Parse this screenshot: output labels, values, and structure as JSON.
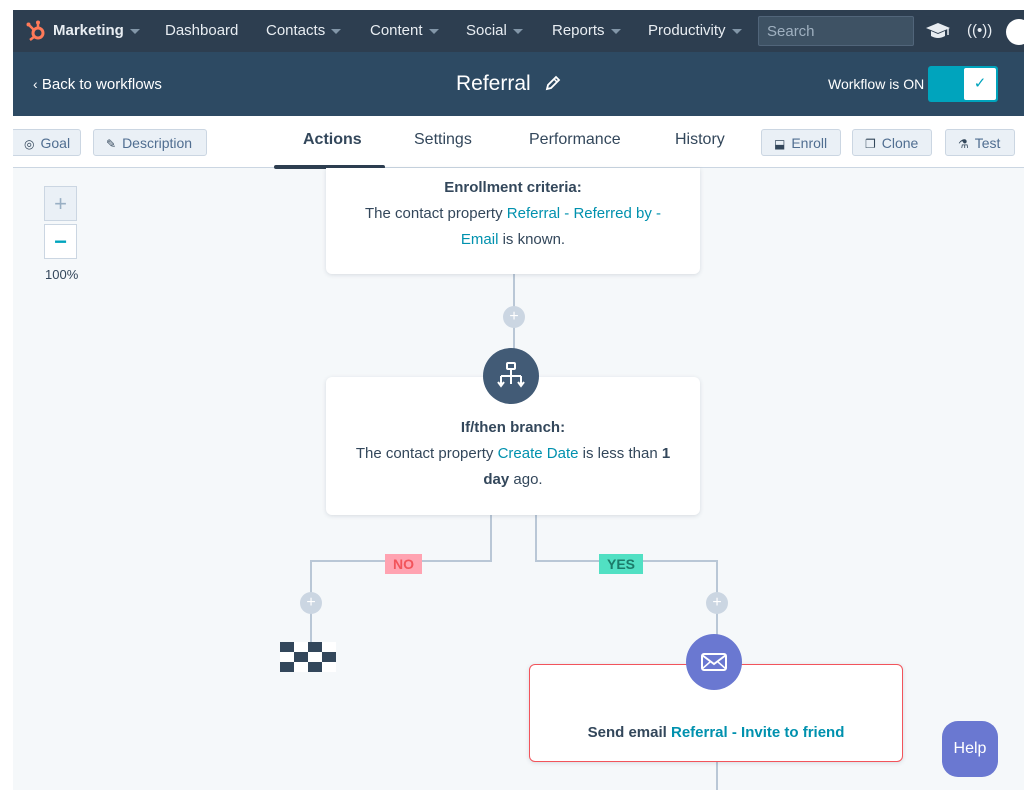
{
  "topnav": {
    "brand": "Marketing",
    "items": [
      {
        "label": "Dashboard"
      },
      {
        "label": "Contacts"
      },
      {
        "label": "Content"
      },
      {
        "label": "Social"
      },
      {
        "label": "Reports"
      },
      {
        "label": "Productivity"
      }
    ],
    "search_placeholder": "Search",
    "icons": [
      "sprocket-logo-icon",
      "graduation-cap-icon",
      "broadcast-icon"
    ],
    "broadcast_glyph": "((•))"
  },
  "header": {
    "back_label": "Back to workflows",
    "title": "Referral",
    "status_label": "Workflow is ON",
    "toggle_on": true,
    "check_glyph": "✓"
  },
  "tabbar": {
    "left_buttons": [
      {
        "label": "Goal",
        "icon": "target-icon"
      },
      {
        "label": "Description",
        "icon": "edit-icon"
      }
    ],
    "tabs": [
      {
        "label": "Actions",
        "active": true
      },
      {
        "label": "Settings"
      },
      {
        "label": "Performance"
      },
      {
        "label": "History"
      }
    ],
    "right_buttons": [
      {
        "label": "Enroll",
        "icon": "enroll-icon"
      },
      {
        "label": "Clone",
        "icon": "clone-icon"
      },
      {
        "label": "Test",
        "icon": "flask-icon"
      }
    ]
  },
  "zoom": {
    "in_glyph": "+",
    "out_glyph": "−",
    "level": "100%"
  },
  "canvas": {
    "plus_glyph": "+",
    "enrollment": {
      "heading": "Enrollment criteria:",
      "text_pre": "The contact property ",
      "property": "Referral - Referred by - Email",
      "property_line1": "Referral - Referred by -",
      "property_line2": "Email",
      "text_post": " is known."
    },
    "branch": {
      "heading": "If/then branch:",
      "text_pre": "The contact property ",
      "property": "Create Date",
      "text_mid": " is less than ",
      "value_num": "1",
      "value_unit": "day",
      "text_post": " ago."
    },
    "no_label": "NO",
    "yes_label": "YES",
    "email_action": {
      "text_pre": "Send email ",
      "email_name": "Referral - Invite to friend"
    }
  },
  "help_label": "Help",
  "colors": {
    "nav_bg": "#2d3e50",
    "header_bg": "#2d4a63",
    "accent_teal": "#00a4bd",
    "link": "#0091ae",
    "branch_node": "#425b76",
    "email_node": "#6a78d1",
    "no_tag_bg": "#ffa3b1",
    "no_tag_text": "#f2545b",
    "yes_tag_bg": "#51e0c3",
    "yes_tag_text": "#1c7b69",
    "error_border": "#f2545b"
  }
}
